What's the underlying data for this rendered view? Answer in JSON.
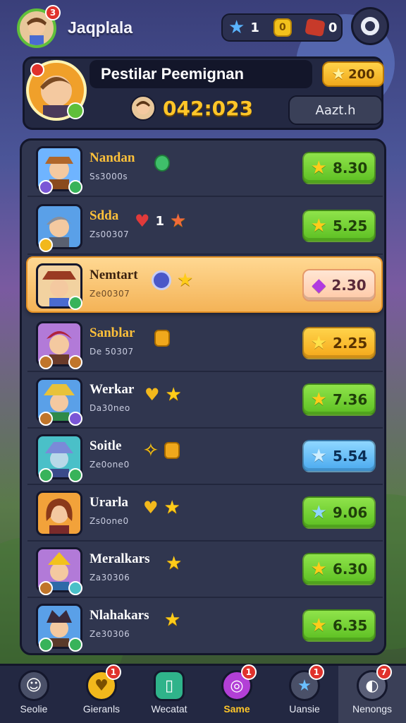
{
  "player": {
    "name": "Jaqplala",
    "notification_count": "3"
  },
  "currency": {
    "stars": "1",
    "coins": "0",
    "gems": "0"
  },
  "event": {
    "title": "Pestilar Peemignan",
    "reward": "200",
    "timer": "042:023",
    "button_label": "Aazt.h"
  },
  "leaderboard": [
    {
      "name": "Nandan",
      "sub": "Ss3000s",
      "extra": "",
      "score": "8.30",
      "style": "green",
      "icon": "star-icon"
    },
    {
      "name": "Sdda",
      "sub": "Zs00307",
      "extra": "1",
      "score": "5.25",
      "style": "green",
      "icon": "star-icon"
    },
    {
      "name": "Nemtart",
      "sub": "Ze00307",
      "extra": "",
      "score": "2.30",
      "style": "pink",
      "icon": "gem-icon"
    },
    {
      "name": "Sanblar",
      "sub": "De 50307",
      "extra": "",
      "score": "2.25",
      "style": "orange",
      "icon": "star-icon"
    },
    {
      "name": "Werkar",
      "sub": "Da30neo",
      "extra": "",
      "score": "7.36",
      "style": "green",
      "icon": "star-icon"
    },
    {
      "name": "Soitle",
      "sub": "Ze0one0",
      "extra": "",
      "score": "5.54",
      "style": "blue",
      "icon": "star-icon"
    },
    {
      "name": "Urarla",
      "sub": "Zs0one0",
      "extra": "",
      "score": "9.06",
      "style": "green",
      "icon": "star-icon"
    },
    {
      "name": "Meralkars",
      "sub": "Za30306",
      "extra": "",
      "score": "6.30",
      "style": "green",
      "icon": "star-icon"
    },
    {
      "name": "Nlahakars",
      "sub": "Ze30306",
      "extra": "",
      "score": "6.35",
      "style": "green",
      "icon": "star-icon"
    }
  ],
  "nav": [
    {
      "label": "Seolie",
      "badge": "",
      "icon": "profile-icon",
      "color": "#4a5068"
    },
    {
      "label": "Gieranls",
      "badge": "1",
      "icon": "shield-icon",
      "color": "#f2b81c"
    },
    {
      "label": "Wecatat",
      "badge": "",
      "icon": "shop-icon",
      "color": "#2fb38a"
    },
    {
      "label": "Same",
      "badge": "1",
      "icon": "target-icon",
      "color": "#b23fd6"
    },
    {
      "label": "Uansie",
      "badge": "1",
      "icon": "star-icon",
      "color": "#4a5068"
    },
    {
      "label": "Nenongs",
      "badge": "7",
      "icon": "globe-icon",
      "color": "#5a5f78"
    }
  ],
  "colors": {
    "accent": "#ffc629",
    "panel": "#30364f",
    "highlight": "#f4b357"
  }
}
